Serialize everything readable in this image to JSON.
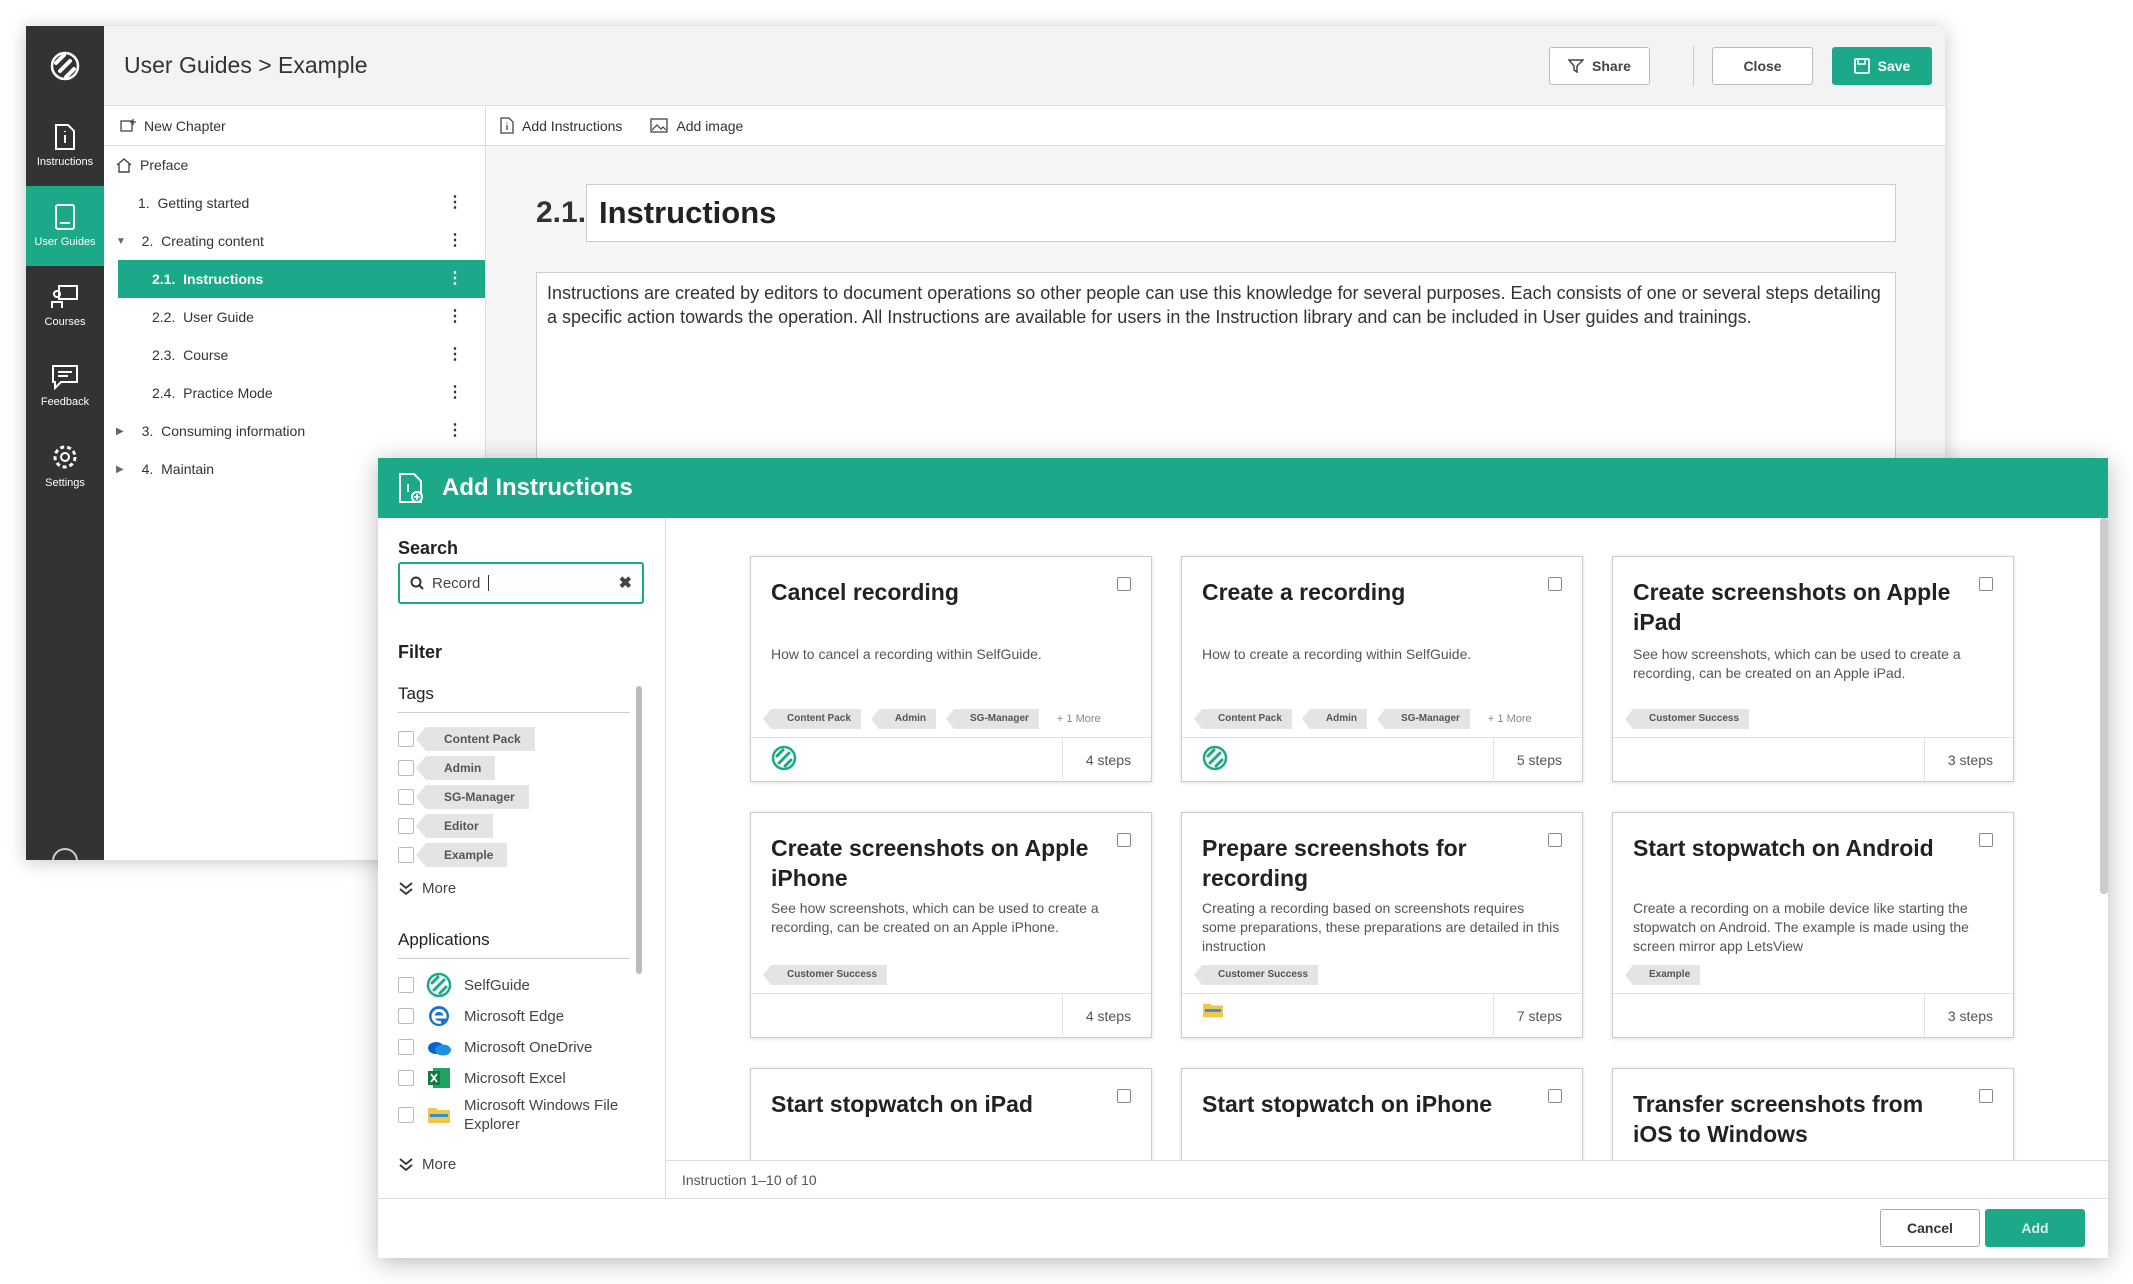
{
  "app": {
    "breadcrumb": "User Guides > Example",
    "share_label": "Share",
    "close_label": "Close",
    "save_label": "Save",
    "accent_color": "#1ba98a"
  },
  "rail": [
    {
      "label": "Instructions",
      "icon": "instructions-icon"
    },
    {
      "label": "User Guides",
      "icon": "user-guides-icon",
      "active": true
    },
    {
      "label": "Courses",
      "icon": "courses-icon"
    },
    {
      "label": "Feedback",
      "icon": "feedback-icon"
    },
    {
      "label": "Settings",
      "icon": "gear-icon"
    }
  ],
  "toc": {
    "new_chapter": "New Chapter",
    "preface": "Preface",
    "items": [
      {
        "num": "1.",
        "label": "Getting started"
      },
      {
        "num": "2.",
        "label": "Creating content"
      },
      {
        "num": "2.1.",
        "label": "Instructions"
      },
      {
        "num": "2.2.",
        "label": "User Guide"
      },
      {
        "num": "2.3.",
        "label": "Course"
      },
      {
        "num": "2.4.",
        "label": "Practice Mode"
      },
      {
        "num": "3.",
        "label": "Consuming information"
      },
      {
        "num": "4.",
        "label": "Maintain"
      }
    ]
  },
  "editor": {
    "add_instructions": "Add Instructions",
    "add_image": "Add image",
    "section_number": "2.1.",
    "section_title": "Instructions",
    "body": "Instructions are created by editors to document operations so other people can use this knowledge for several purposes. Each consists of one or several steps detailing a specific action towards the operation. All Instructions are available for users in the Instruction library and can be included in User guides and trainings."
  },
  "modal": {
    "title": "Add Instructions",
    "search_label": "Search",
    "search_value": "Record",
    "filter_label": "Filter",
    "tags_label": "Tags",
    "tags": [
      "Content Pack",
      "Admin",
      "SG-Manager",
      "Editor",
      "Example"
    ],
    "more_label": "More",
    "applications_label": "Applications",
    "applications": [
      "SelfGuide",
      "Microsoft Edge",
      "Microsoft OneDrive",
      "Microsoft Excel",
      "Microsoft Windows File Explorer"
    ],
    "status": "Instruction 1–10 of 10",
    "cancel_label": "Cancel",
    "add_label": "Add",
    "cards": [
      {
        "title": "Cancel recording",
        "desc": "How to cancel a recording within SelfGuide.",
        "tags": [
          "Content Pack",
          "Admin",
          "SG-Manager"
        ],
        "more": "+ 1 More",
        "app": "selfguide-icon",
        "steps": "4 steps"
      },
      {
        "title": "Create a recording",
        "desc": "How to create a recording within SelfGuide.",
        "tags": [
          "Content Pack",
          "Admin",
          "SG-Manager"
        ],
        "more": "+ 1 More",
        "app": "selfguide-icon",
        "steps": "5 steps"
      },
      {
        "title": "Create screenshots on Apple iPad",
        "desc": "See how screenshots, which can be used to create a recording, can be created on an Apple iPad.",
        "tags": [
          "Customer Success"
        ],
        "more": "",
        "app": "",
        "steps": "3 steps"
      },
      {
        "title": "Create screenshots on Apple iPhone",
        "desc": "See how screenshots, which can be used to create a recording, can be created on an Apple iPhone.",
        "tags": [
          "Customer Success"
        ],
        "more": "",
        "app": "",
        "steps": "4 steps"
      },
      {
        "title": "Prepare screenshots for recording",
        "desc": "Creating a recording based on screenshots requires some preparations, these preparations are detailed in this instruction",
        "tags": [
          "Customer Success"
        ],
        "more": "",
        "app": "file-explorer-icon",
        "steps": "7 steps"
      },
      {
        "title": "Start stopwatch on Android",
        "desc": "Create a recording on a mobile device like starting the stopwatch on Android. The example is made using the screen mirror app LetsView",
        "tags": [
          "Example"
        ],
        "more": "",
        "app": "",
        "steps": "3 steps"
      },
      {
        "title": "Start stopwatch on iPad",
        "desc": "",
        "tags": [],
        "more": "",
        "app": "",
        "steps": ""
      },
      {
        "title": "Start stopwatch on iPhone",
        "desc": "",
        "tags": [],
        "more": "",
        "app": "",
        "steps": ""
      },
      {
        "title": "Transfer screenshots from iOS to Windows",
        "desc": "",
        "tags": [],
        "more": "",
        "app": "",
        "steps": ""
      }
    ]
  }
}
